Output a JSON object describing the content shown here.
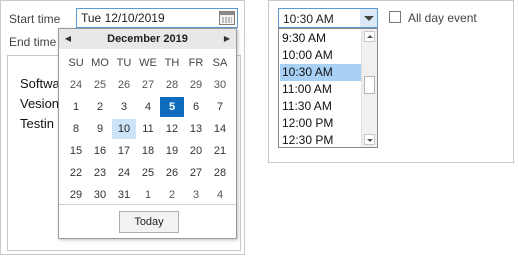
{
  "left": {
    "start_label": "Start time",
    "start_value": "Tue 12/10/2019",
    "end_label": "End time",
    "body_lines": [
      "Softwa",
      "Vesion",
      "Testin"
    ]
  },
  "calendar": {
    "month_label": "December 2019",
    "prev_icon": "◀",
    "next_icon": "▶",
    "weekdays": [
      "SU",
      "MO",
      "TU",
      "WE",
      "TH",
      "FR",
      "SA"
    ],
    "weeks": [
      [
        "24",
        "25",
        "26",
        "27",
        "28",
        "29",
        "30"
      ],
      [
        "1",
        "2",
        "3",
        "4",
        "5",
        "6",
        "7"
      ],
      [
        "8",
        "9",
        "10",
        "11",
        "12",
        "13",
        "14"
      ],
      [
        "15",
        "16",
        "17",
        "18",
        "19",
        "20",
        "21"
      ],
      [
        "22",
        "23",
        "24",
        "25",
        "26",
        "27",
        "28"
      ],
      [
        "29",
        "30",
        "31",
        "1",
        "2",
        "3",
        "4"
      ]
    ],
    "today_button": "Today",
    "selected_day": "5",
    "today_day": "10"
  },
  "right": {
    "time_value": "10:30 AM",
    "allday_label": "All day event",
    "time_options": [
      "9:30 AM",
      "10:00 AM",
      "10:30 AM",
      "11:00 AM",
      "11:30 AM",
      "12:00 PM",
      "12:30 PM"
    ],
    "selected_time": "10:30 AM"
  },
  "colors": {
    "accent": "#0f6cbd",
    "today_highlight": "#cce4f7",
    "list_selection": "#a9d1f5"
  }
}
